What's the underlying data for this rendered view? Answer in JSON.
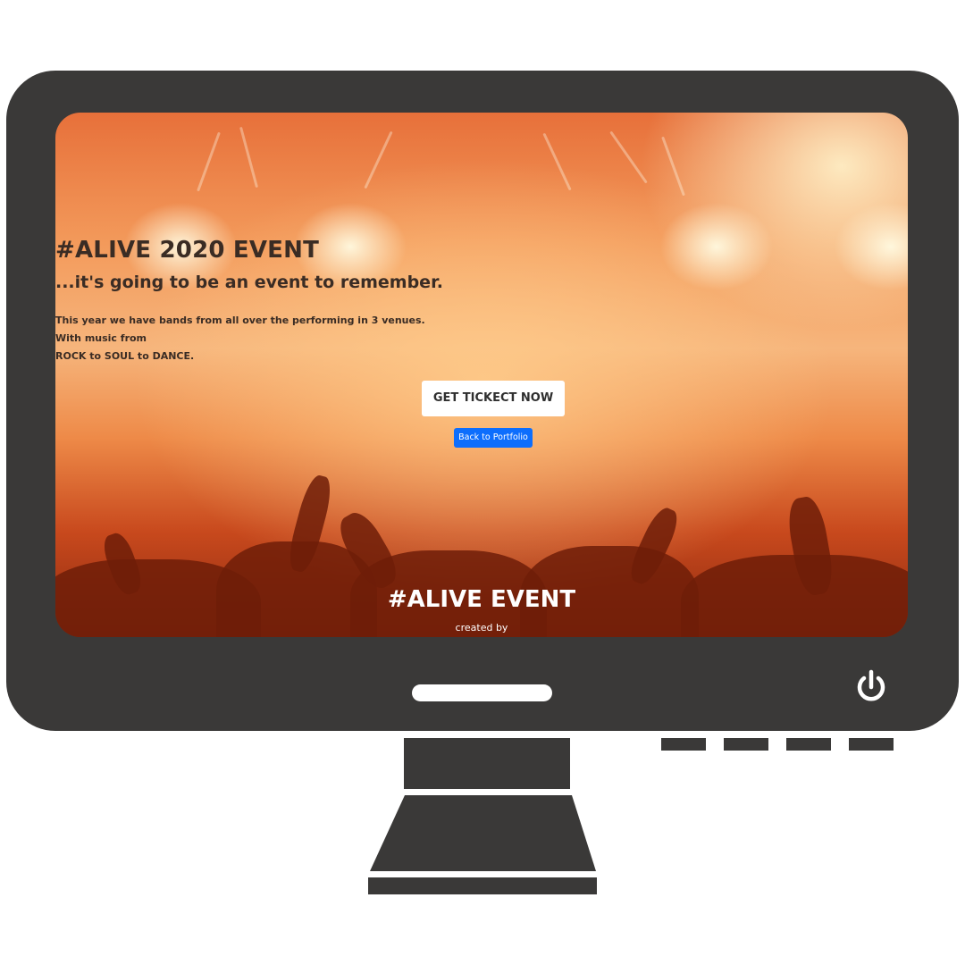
{
  "page": {
    "hero": {
      "title": "#ALIVE 2020 EVENT",
      "subtitle": "...it's going to be an event to remember.",
      "description_lines": [
        "This year we have bands from all over the performing in 3 venues.",
        "With music from",
        "ROCK to SOUL to DANCE."
      ],
      "ticket_button_label": "GET TICKECT NOW",
      "back_button_label": "Back to Portfolio"
    },
    "footer": {
      "title": "#ALIVE EVENT",
      "credit": "created by"
    }
  },
  "colors": {
    "monitor": "#3a3938",
    "back_button": "#0d6efd",
    "ticket_button": "#ffffff"
  },
  "icons": {
    "power": "power-icon"
  }
}
